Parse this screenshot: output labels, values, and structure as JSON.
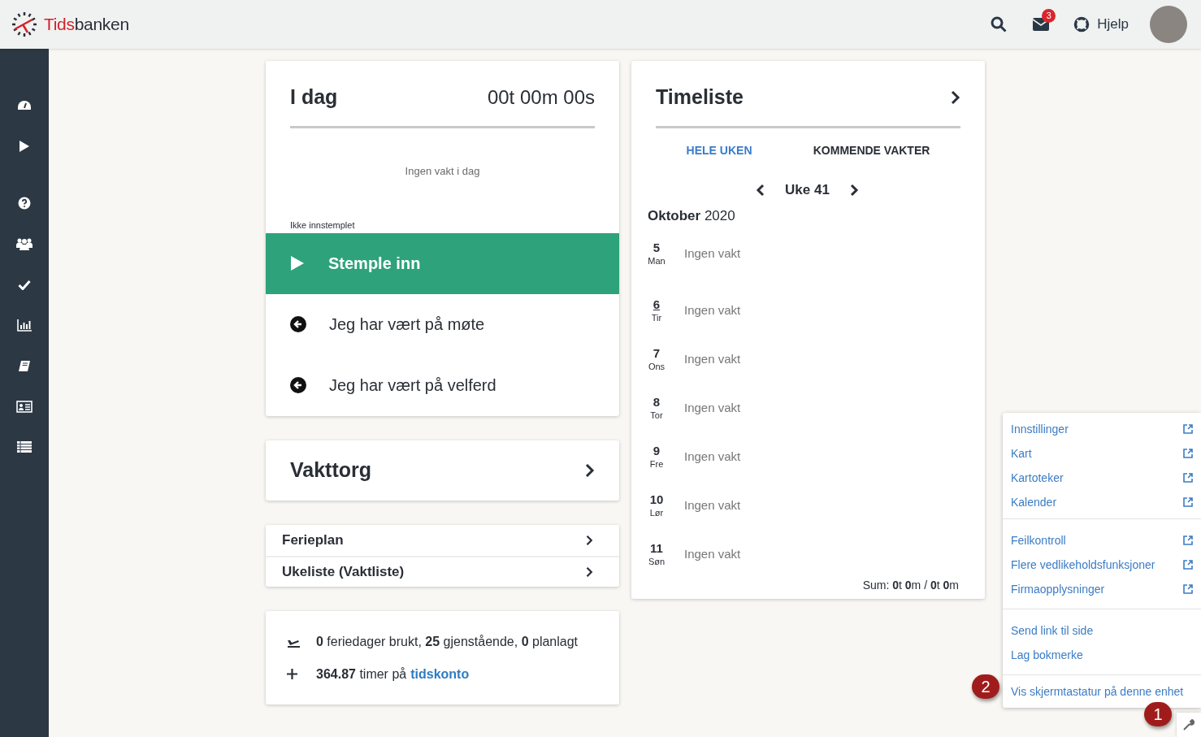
{
  "header": {
    "logo": {
      "part_1": "Tids",
      "part_2": "banken"
    },
    "mail_badge": "3",
    "help": "Hjelp"
  },
  "today": {
    "title": "I dag",
    "timer": "00t 00m 00s",
    "no_shift": "Ingen vakt i dag",
    "status": "Ikke innstemplet",
    "clock_in": "Stemple inn",
    "actions": [
      {
        "label": "Jeg har vært på møte"
      },
      {
        "label": "Jeg har vært på velferd"
      }
    ]
  },
  "market": {
    "title": "Vakttorg"
  },
  "links": [
    {
      "label": "Ferieplan"
    },
    {
      "label": "Ukeliste (Vaktliste)"
    }
  ],
  "summary": {
    "vacation": "**0** feriedager brukt, **25** gjenstående, **0** planlagt",
    "hours": "**364.87** timer på",
    "hours_link": "tidskonto"
  },
  "timesheet": {
    "title": "Timeliste",
    "tabs": [
      {
        "label": "HELE UKEN",
        "selected": true
      },
      {
        "label": "KOMMENDE VAKTER",
        "selected": false
      }
    ],
    "week": "Uke 41",
    "month": "Oktober",
    "year": "2020",
    "days": [
      {
        "date": "5",
        "weekday": "Man",
        "shift": "Ingen vakt",
        "today": false
      },
      {
        "date": "6",
        "weekday": "Tir",
        "shift": "Ingen vakt",
        "today": true
      },
      {
        "date": "7",
        "weekday": "Ons",
        "shift": "Ingen vakt",
        "today": false
      },
      {
        "date": "8",
        "weekday": "Tor",
        "shift": "Ingen vakt",
        "today": false
      },
      {
        "date": "9",
        "weekday": "Fre",
        "shift": "Ingen vakt",
        "today": false
      },
      {
        "date": "10",
        "weekday": "Lør",
        "shift": "Ingen vakt",
        "today": false
      },
      {
        "date": "11",
        "weekday": "Søn",
        "shift": "Ingen vakt",
        "today": false
      }
    ],
    "sum": "Sum: **0**t **0**m / **0**t **0**m"
  },
  "menu": {
    "groups": [
      [
        {
          "label": "Innstillinger",
          "external": true
        },
        {
          "label": "Kart",
          "external": true
        },
        {
          "label": "Kartoteker",
          "external": true
        },
        {
          "label": "Kalender",
          "external": true
        }
      ],
      [
        {
          "label": "Feilkontroll",
          "external": true
        },
        {
          "label": "Flere vedlikeholdsfunksjoner",
          "external": true
        },
        {
          "label": "Firmaopplysninger",
          "external": true
        }
      ],
      [
        {
          "label": "Send link til side",
          "external": false
        },
        {
          "label": "Lag bokmerke",
          "external": false
        }
      ],
      [
        {
          "label": "Vis skjermtastatur på denne enhet",
          "external": false
        }
      ]
    ]
  },
  "annotations": [
    {
      "label": "1"
    },
    {
      "label": "2"
    }
  ]
}
